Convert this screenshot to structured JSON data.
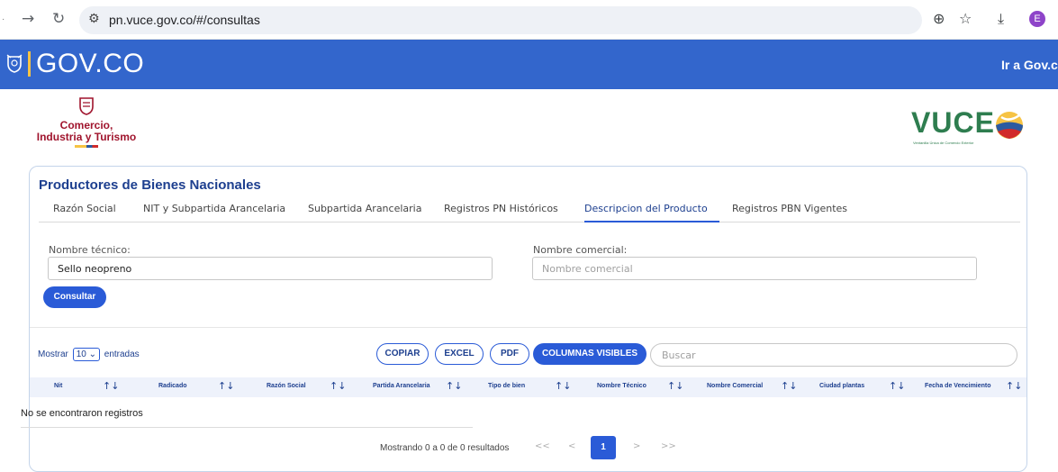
{
  "browser": {
    "url": "pn.vuce.gov.co/#/consultas",
    "profile_initial": "E",
    "icons": [
      "back-icon",
      "forward-icon",
      "reload-icon",
      "site-settings-icon",
      "zoom-icon",
      "bookmark-star-icon",
      "download-icon"
    ]
  },
  "govbar": {
    "logo": "GOV.CO",
    "link": "Ir a Gov.co",
    "color": "#3366cc"
  },
  "header": {
    "ministry_line1": "Comercio,",
    "ministry_line2": "Industria y Turismo",
    "vuce_logo": "VUCE",
    "vuce_subtitle": "Ventanilla Única de Comercio Exterior"
  },
  "card": {
    "title": "Productores de Bienes Nacionales",
    "tabs": [
      {
        "label": "Razón Social"
      },
      {
        "label": "NIT y Subpartida Arancelaria"
      },
      {
        "label": "Subpartida Arancelaria"
      },
      {
        "label": "Registros PN Históricos"
      },
      {
        "label": "Descripcion del Producto"
      },
      {
        "label": "Registros PBN Vigentes"
      }
    ],
    "active_tab": "Descripcion del Producto",
    "form": {
      "nombre_tecnico_label": "Nombre técnico:",
      "nombre_tecnico_value": "Sello neopreno",
      "nombre_comercial_label": "Nombre comercial:",
      "nombre_comercial_placeholder": "Nombre comercial",
      "consultar": "Consultar"
    }
  },
  "table_controls": {
    "mostrar": "Mostrar",
    "entries_value": "10",
    "entradas": "entradas",
    "buttons": {
      "copiar": "COPIAR",
      "excel": "EXCEL",
      "pdf": "PDF",
      "columnas": "COLUMNAS VISIBLES"
    },
    "search_placeholder": "Buscar"
  },
  "table": {
    "columns": [
      "Nit",
      "Radicado",
      "Razón Social",
      "Partida Arancelaria",
      "Tipo de bien",
      "Nombre Técnico",
      "Nombre Comercial",
      "Ciudad plantas",
      "Fecha de Vencimiento"
    ],
    "sort_glyph": "↑↓",
    "empty_message": "No se encontraron registros"
  },
  "pagination": {
    "summary": "Mostrando 0 a 0 de 0 resultados",
    "first": "<<",
    "prev": "<",
    "current": "1",
    "next": ">",
    "last": ">>"
  },
  "colors": {
    "accent": "#2a5bd7",
    "title": "#1d3f8f",
    "ministry": "#a0142d",
    "vuce_green": "#2e7d4f"
  }
}
